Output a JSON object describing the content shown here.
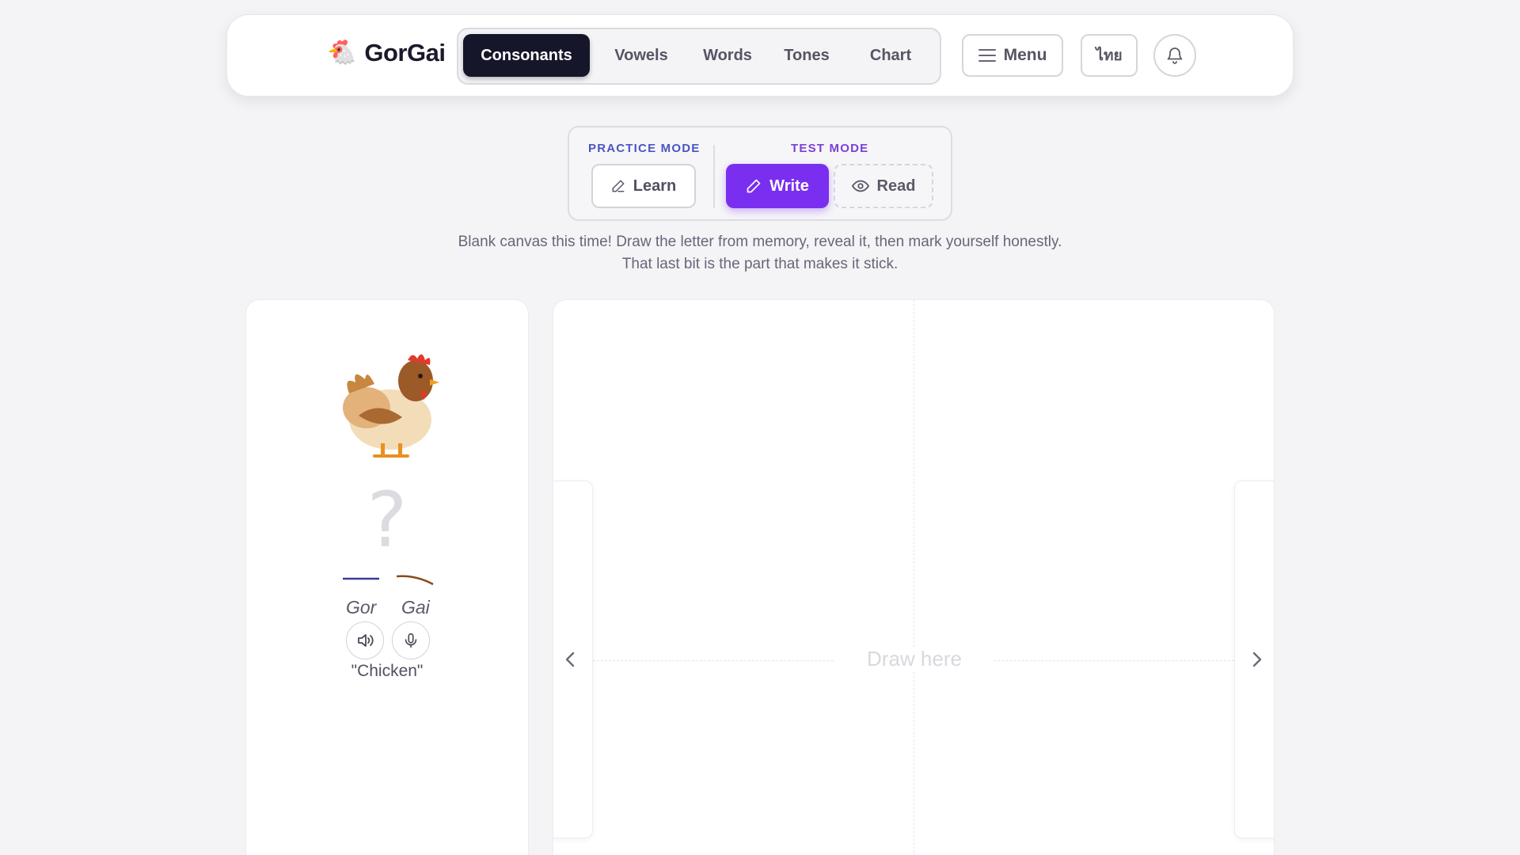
{
  "brand": {
    "logo": "🐔",
    "name": "GorGai"
  },
  "nav": {
    "tabs": [
      {
        "label": "Consonants",
        "active": true
      },
      {
        "label": "Vowels",
        "active": false
      },
      {
        "label": "Words",
        "active": false
      },
      {
        "label": "Tones",
        "active": false
      },
      {
        "label": "Chart",
        "active": false
      }
    ],
    "menu_label": "Menu",
    "lang_label": "ไทย"
  },
  "modes": {
    "practice_label": "PRACTICE MODE",
    "test_label": "TEST MODE",
    "learn_label": "Learn",
    "write_label": "Write",
    "read_label": "Read",
    "active": "Write"
  },
  "description": "Blank canvas this time! Draw the letter from memory, reveal it, then mark yourself honestly. That last bit is the part that makes it stick.",
  "card": {
    "image": "🐔",
    "hidden_letter": "?",
    "syllables": [
      {
        "text": "Gor",
        "tone": "mid",
        "color": "#3a3a9a"
      },
      {
        "text": "Gai",
        "tone": "falling",
        "color": "#8a4a1a"
      }
    ],
    "meaning": "\"Chicken\""
  },
  "canvas": {
    "placeholder": "Draw here"
  },
  "colors": {
    "accent_purple": "#7a2ff0",
    "nav_active": "#16162a",
    "practice_blue": "#4a55c4",
    "test_purple": "#7b3fd6"
  },
  "icons": [
    "bell-icon",
    "menu-icon",
    "pencil-icon",
    "eye-icon",
    "speaker-icon",
    "microphone-icon",
    "chevron-left-icon",
    "chevron-right-icon"
  ]
}
